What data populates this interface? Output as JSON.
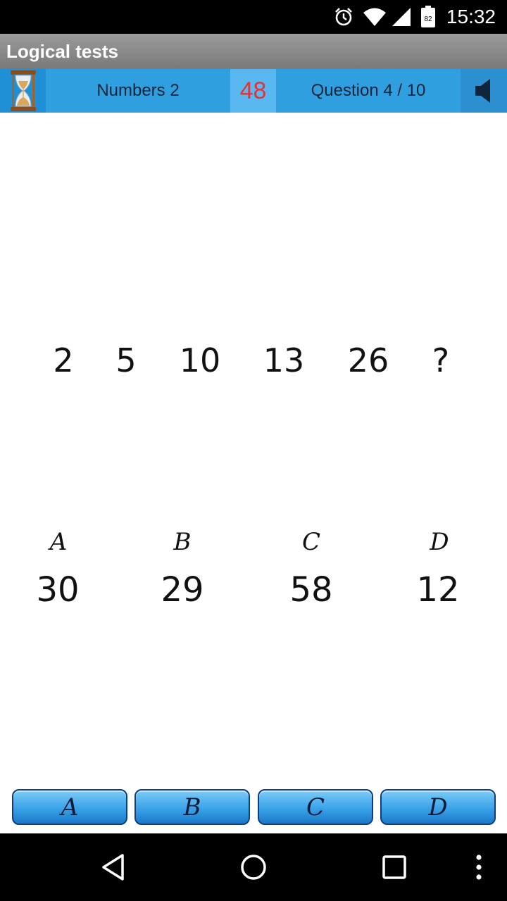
{
  "status_bar": {
    "time": "15:32",
    "battery_level": "82",
    "icons": [
      "alarm-icon",
      "wifi-icon",
      "signal-icon",
      "battery-icon"
    ]
  },
  "app_bar": {
    "title": "Logical tests"
  },
  "info_bar": {
    "category": "Numbers 2",
    "timer": "48",
    "question": "Question 4 / 10",
    "icons": [
      "hourglass-icon",
      "speaker-icon"
    ]
  },
  "sequence": [
    "2",
    "5",
    "10",
    "13",
    "26",
    "?"
  ],
  "options": [
    {
      "letter": "A",
      "value": "30"
    },
    {
      "letter": "B",
      "value": "29"
    },
    {
      "letter": "C",
      "value": "58"
    },
    {
      "letter": "D",
      "value": "12"
    }
  ],
  "answer_buttons": [
    "A",
    "B",
    "C",
    "D"
  ],
  "colors": {
    "info_bar": "#2f9fe0",
    "timer_text": "#e0343a",
    "app_bar": "#8a8a8a"
  },
  "nav_bar": {
    "icons": [
      "back-icon",
      "home-icon",
      "recents-icon",
      "more-icon"
    ]
  }
}
